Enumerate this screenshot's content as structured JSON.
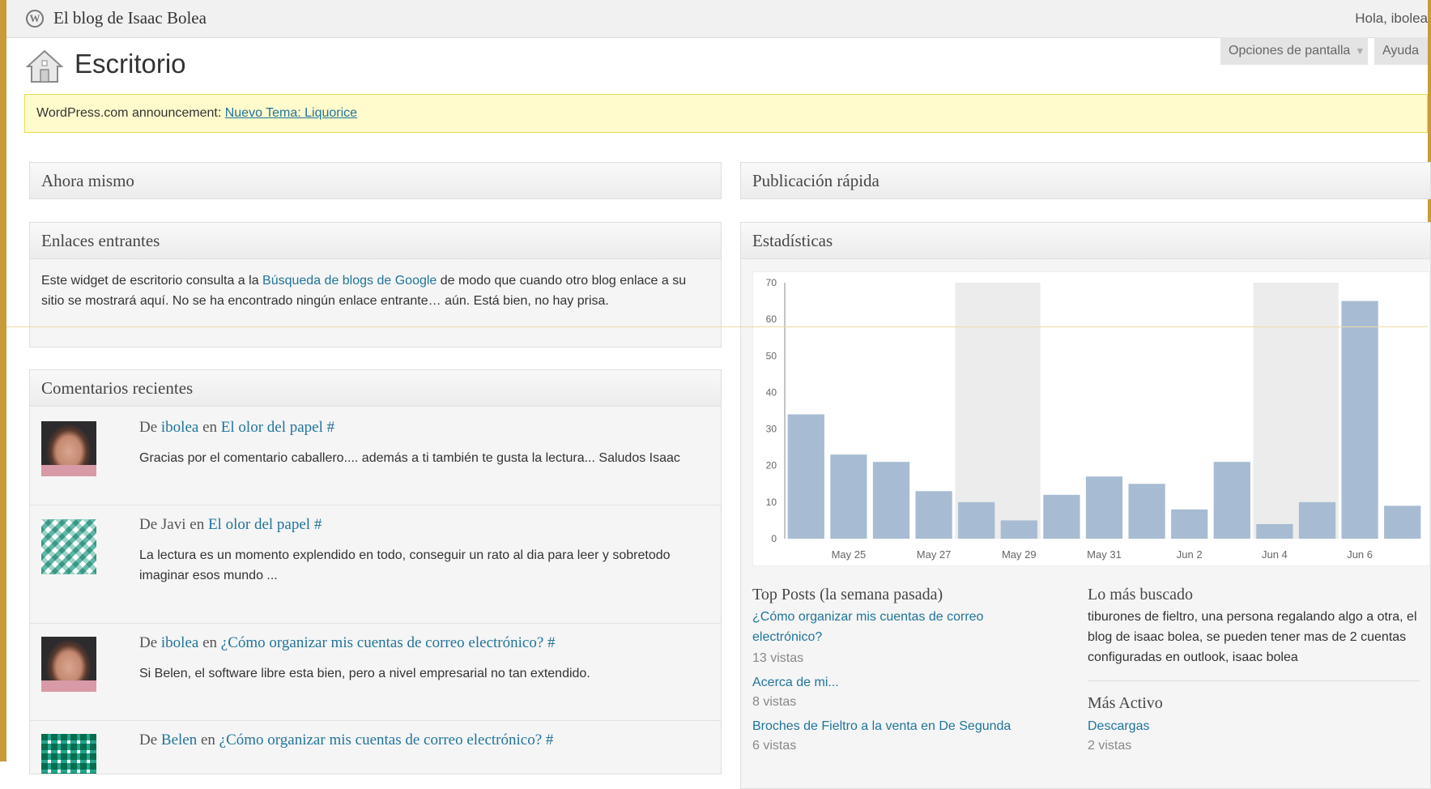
{
  "adminbar": {
    "site_title": "El blog de Isaac Bolea",
    "howdy": "Hola, ibolea"
  },
  "header": {
    "title": "Escritorio",
    "screen_options": "Opciones de pantalla",
    "help": "Ayuda"
  },
  "notice": {
    "prefix": "WordPress.com announcement:",
    "link": "Nuevo Tema: Liquorice"
  },
  "panels": {
    "right_now": {
      "title": "Ahora mismo"
    },
    "quick_press": {
      "title": "Publicación rápida"
    },
    "incoming": {
      "title": "Enlaces entrantes",
      "text_before": "Este widget de escritorio consulta a la ",
      "link": "Búsqueda de blogs de Google",
      "text_after": " de modo que cuando otro blog enlace a su sitio se mostrará aquí. No se ha encontrado ningún enlace entrante… aún. Está bien, no hay prisa."
    },
    "comments": {
      "title": "Comentarios recientes",
      "items": [
        {
          "from": "De",
          "author": "ibolea",
          "on": "en",
          "post": "El olor del papel",
          "hash": "#",
          "text": "Gracias por el comentario caballero.... además a ti también te gusta la lectura... Saludos Isaac"
        },
        {
          "from": "De",
          "author": "Javi",
          "on": "en",
          "post": "El olor del papel",
          "hash": "#",
          "text": "La lectura es un momento explendido en todo, conseguir un rato al dia para leer y sobretodo imaginar esos mundo ..."
        },
        {
          "from": "De",
          "author": "ibolea",
          "on": "en",
          "post": "¿Cómo organizar mis cuentas de correo electrónico?",
          "hash": "#",
          "text": "Si Belen, el software libre esta bien, pero a nivel empresarial no tan extendido."
        },
        {
          "from": "De",
          "author": "Belen",
          "on": "en",
          "post": "¿Cómo organizar mis cuentas de correo electrónico?",
          "hash": "#",
          "text": ""
        }
      ]
    },
    "stats": {
      "title": "Estadísticas",
      "top_posts_title": "Top Posts (la semana pasada)",
      "top_posts": [
        {
          "title": "¿Cómo organizar mis cuentas de correo electrónico?",
          "views": "13 vistas"
        },
        {
          "title": "Acerca de mi...",
          "views": "8 vistas"
        },
        {
          "title": "Broches de Fieltro a la venta en De Segunda",
          "views": "6 vistas"
        }
      ],
      "most_searched_title": "Lo más buscado",
      "most_searched_text": "tiburones de fieltro, una persona regalando algo a otra, el blog de isaac bolea, se pueden tener mas de 2 cuentas configuradas en outlook, isaac bolea",
      "most_active_title": "Más Activo",
      "most_active": [
        {
          "title": "Descargas",
          "views": "2 vistas"
        }
      ]
    }
  },
  "colors": {
    "bar": "#a7bcd2",
    "weekend_band": "#ececec",
    "link": "#21759b",
    "notice_bg": "#fffbcc"
  },
  "chart_data": {
    "type": "bar",
    "days": [
      "May 24",
      "May 25",
      "May 26",
      "May 27",
      "May 28",
      "May 29",
      "May 30",
      "May 31",
      "Jun 1",
      "Jun 2",
      "Jun 3",
      "Jun 4",
      "Jun 5",
      "Jun 6",
      "Jun 7"
    ],
    "values": [
      34,
      23,
      21,
      13,
      10,
      5,
      12,
      17,
      15,
      8,
      21,
      4,
      10,
      65,
      9
    ],
    "x_tick_labels": [
      "May 25",
      "May 27",
      "May 29",
      "May 31",
      "Jun 2",
      "Jun 4",
      "Jun 6"
    ],
    "y_ticks": [
      0,
      10,
      20,
      30,
      40,
      50,
      60,
      70
    ],
    "ylim": [
      0,
      70
    ],
    "weekend_bands": [
      [
        "May 28",
        "May 29"
      ],
      [
        "Jun 4",
        "Jun 5"
      ]
    ],
    "grid": false
  }
}
